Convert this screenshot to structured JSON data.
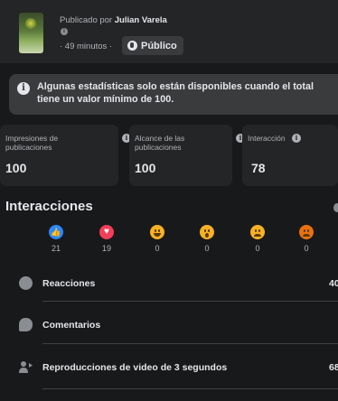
{
  "post": {
    "published_prefix": "Publicado por ",
    "author": "Julian Varela",
    "time": "· 49 minutos ·",
    "audience_label": "Público"
  },
  "notice": {
    "text": "Algunas estadísticas solo están disponibles cuando el total tiene un valor mínimo de 100."
  },
  "stats": [
    {
      "label": "Impresiones de publicaciones",
      "value": "100"
    },
    {
      "label": "Alcance de las publicaciones",
      "value": "100"
    },
    {
      "label": "Interacción",
      "value": "78"
    }
  ],
  "interactions": {
    "title": "Interacciones",
    "reactions": [
      {
        "icon": "like-reaction-icon",
        "count": "21"
      },
      {
        "icon": "love-reaction-icon",
        "count": "19"
      },
      {
        "icon": "haha-reaction-icon",
        "count": "0"
      },
      {
        "icon": "wow-reaction-icon",
        "count": "0"
      },
      {
        "icon": "sad-reaction-icon",
        "count": "0"
      },
      {
        "icon": "angry-reaction-icon",
        "count": "0"
      }
    ],
    "rows": [
      {
        "label": "Reacciones",
        "value": "40",
        "icon": "smiley-icon"
      },
      {
        "label": "Comentarios",
        "value": "",
        "icon": "comment-bubble-icon"
      },
      {
        "label": "Reproducciones de video de 3 segundos",
        "value": "68",
        "icon": "people-play-icon"
      }
    ]
  },
  "colors": {
    "background": "#18191a",
    "card": "#242526",
    "like": "#2d88ff",
    "love": "#f33e58",
    "reaction_yellow": "#f7b125",
    "angry": "#e9710f"
  }
}
